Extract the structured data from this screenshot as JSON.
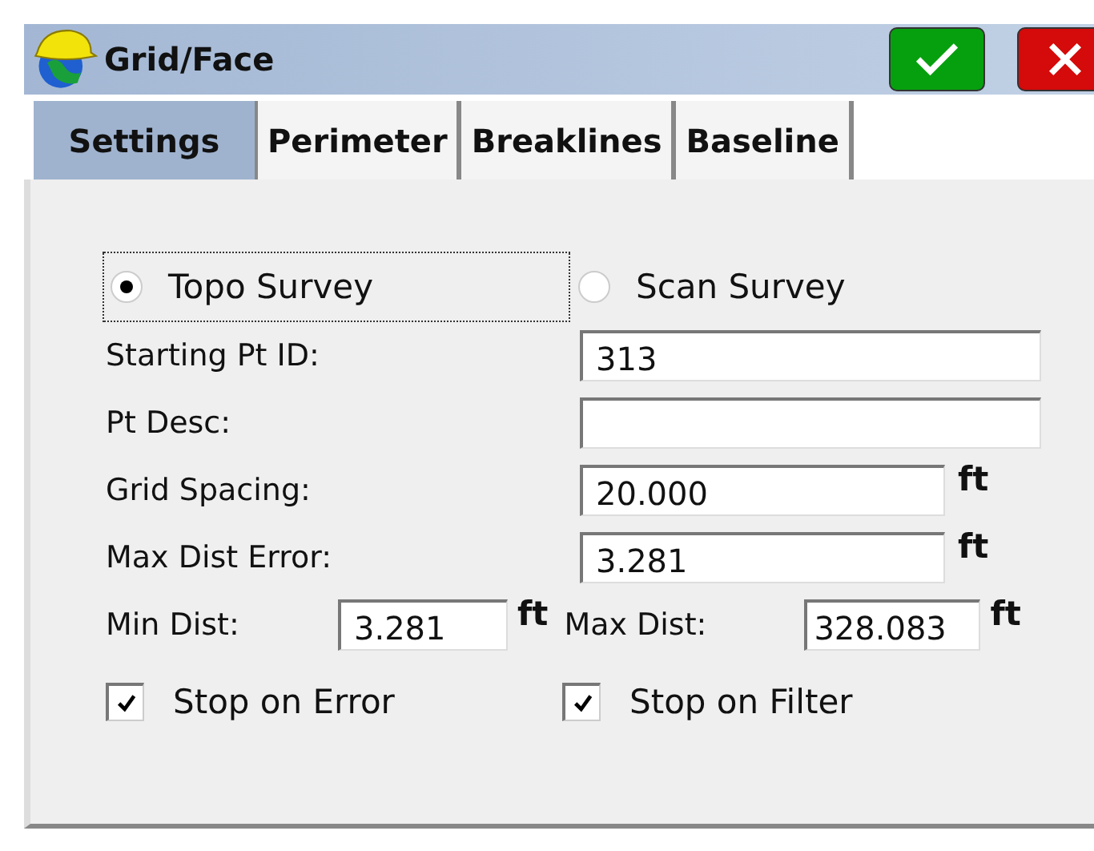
{
  "window": {
    "title": "Grid/Face"
  },
  "tabs": [
    {
      "label": "Settings",
      "selected": true
    },
    {
      "label": "Perimeter",
      "selected": false
    },
    {
      "label": "Breaklines",
      "selected": false
    },
    {
      "label": "Baseline",
      "selected": false
    }
  ],
  "survey_type": [
    {
      "label": "Topo Survey",
      "selected": true
    },
    {
      "label": "Scan Survey",
      "selected": false
    }
  ],
  "fields": [
    {
      "label": "Starting Pt ID:",
      "value": "313"
    },
    {
      "label": "Pt Desc:"
    },
    {
      "label": "Grid Spacing:",
      "value": "20.000",
      "unit": "ft"
    },
    {
      "label": "Max Dist Error:",
      "value": "3.281",
      "unit": "ft"
    }
  ],
  "distance_limits": [
    {
      "label": "Min Dist:",
      "value": "3.281",
      "unit": "ft"
    },
    {
      "label": "Max Dist:",
      "value": "328.083",
      "unit": "ft"
    }
  ],
  "options": [
    {
      "label": "Stop on Error",
      "checked": true
    },
    {
      "label": "Stop on Filter",
      "checked": true
    }
  ]
}
